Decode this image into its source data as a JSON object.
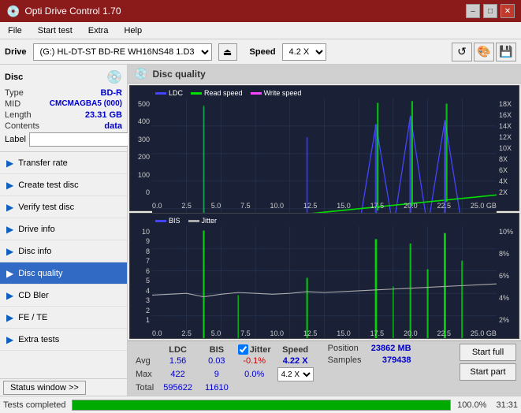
{
  "titleBar": {
    "title": "Opti Drive Control 1.70",
    "minBtn": "–",
    "maxBtn": "□",
    "closeBtn": "✕"
  },
  "menuBar": {
    "items": [
      "File",
      "Start test",
      "Extra",
      "Help"
    ]
  },
  "driveBar": {
    "label": "Drive",
    "driveValue": "(G:)  HL-DT-ST BD-RE  WH16NS48 1.D3",
    "ejectIcon": "⏏",
    "speedLabel": "Speed",
    "speedValue": "4.2 X",
    "toolbarIcons": [
      "↺",
      "🎨",
      "💾"
    ]
  },
  "disc": {
    "title": "Disc",
    "typeLabel": "Type",
    "typeValue": "BD-R",
    "midLabel": "MID",
    "midValue": "CMCMAGBA5 (000)",
    "lengthLabel": "Length",
    "lengthValue": "23.31 GB",
    "contentsLabel": "Contents",
    "contentsValue": "data",
    "labelLabel": "Label",
    "labelValue": ""
  },
  "navItems": [
    {
      "id": "transfer-rate",
      "label": "Transfer rate",
      "active": false
    },
    {
      "id": "create-test-disc",
      "label": "Create test disc",
      "active": false
    },
    {
      "id": "verify-test-disc",
      "label": "Verify test disc",
      "active": false
    },
    {
      "id": "drive-info",
      "label": "Drive info",
      "active": false
    },
    {
      "id": "disc-info",
      "label": "Disc info",
      "active": false
    },
    {
      "id": "disc-quality",
      "label": "Disc quality",
      "active": true
    },
    {
      "id": "cd-bler",
      "label": "CD Bler",
      "active": false
    },
    {
      "id": "fe-te",
      "label": "FE / TE",
      "active": false
    },
    {
      "id": "extra-tests",
      "label": "Extra tests",
      "active": false
    }
  ],
  "contentTitle": "Disc quality",
  "chartTop": {
    "legend": [
      {
        "id": "ldc",
        "label": "LDC",
        "color": "#4444ff"
      },
      {
        "id": "read",
        "label": "Read speed",
        "color": "#00ff00"
      },
      {
        "id": "write",
        "label": "Write speed",
        "color": "#ff44ff"
      }
    ],
    "yLabels": [
      "500",
      "400",
      "300",
      "200",
      "100",
      "0"
    ],
    "yLabelsRight": [
      "18X",
      "16X",
      "14X",
      "12X",
      "10X",
      "8X",
      "6X",
      "4X",
      "2X"
    ],
    "xLabels": [
      "0.0",
      "2.5",
      "5.0",
      "7.5",
      "10.0",
      "12.5",
      "15.0",
      "17.5",
      "20.0",
      "22.5",
      "25.0"
    ],
    "xUnit": "GB"
  },
  "chartBottom": {
    "legend": [
      {
        "id": "bis",
        "label": "BIS",
        "color": "#4444ff"
      },
      {
        "id": "jitter",
        "label": "Jitter",
        "color": "#aaaaaa"
      }
    ],
    "yLabels": [
      "10",
      "9",
      "8",
      "7",
      "6",
      "5",
      "4",
      "3",
      "2",
      "1"
    ],
    "yLabelsRight": [
      "10%",
      "8%",
      "6%",
      "4%",
      "2%"
    ],
    "xLabels": [
      "0.0",
      "2.5",
      "5.0",
      "7.5",
      "10.0",
      "12.5",
      "15.0",
      "17.5",
      "20.0",
      "22.5",
      "25.0"
    ],
    "xUnit": "GB"
  },
  "stats": {
    "headers": [
      "LDC",
      "BIS",
      "",
      "Jitter",
      "Speed"
    ],
    "avgLabel": "Avg",
    "avgLDC": "1.56",
    "avgBIS": "0.03",
    "avgJitter": "-0.1%",
    "avgSpeed": "4.22 X",
    "maxLabel": "Max",
    "maxLDC": "422",
    "maxBIS": "9",
    "maxJitter": "0.0%",
    "totalLabel": "Total",
    "totalLDC": "595622",
    "totalBIS": "11610",
    "jitterChecked": true,
    "jitterLabel": "Jitter",
    "speedDropdown": "4.2 X",
    "positionLabel": "Position",
    "positionValue": "23862 MB",
    "samplesLabel": "Samples",
    "samplesValue": "379438",
    "startFullBtn": "Start full",
    "startPartBtn": "Start part"
  },
  "statusBar": {
    "statusWindowBtn": "Status window >>",
    "progressPercent": 100,
    "progressLabel": "100.0%",
    "timeLabel": "31:31"
  },
  "colors": {
    "titleBarBg": "#8B1A1A",
    "activeNav": "#316ac5",
    "chartBg": "#1a2035",
    "gridColor": "#2a3a5a",
    "ldcColor": "#4444ff",
    "bisColor": "#4444ff",
    "readSpeedColor": "#00dd00",
    "jitterColor": "#888888",
    "spikeColor": "#00ff00"
  }
}
